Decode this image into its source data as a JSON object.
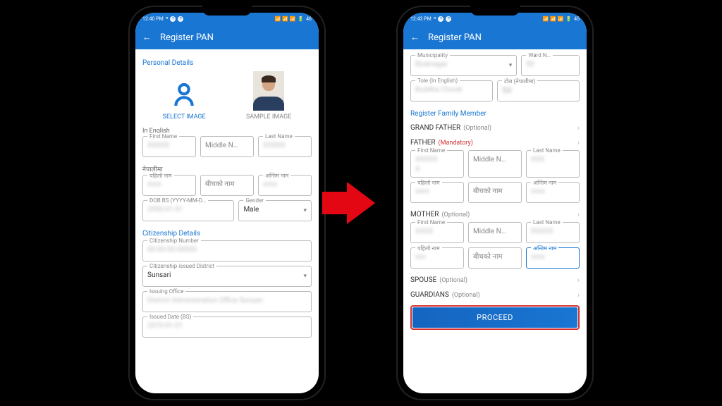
{
  "statusbar_left": {
    "time1": "12:40 PM",
    "time2": "12:43 PM",
    "quote": "❝"
  },
  "statusbar_right": {
    "net1": "46",
    "net2": "45"
  },
  "appbar": {
    "title": "Register PAN"
  },
  "left": {
    "section_personal": "Personal Details",
    "select_image": "SELECT IMAGE",
    "sample_image": "SAMPLE IMAGE",
    "in_english": "In English",
    "first_name_label": "First Name",
    "middle_name_place": "Middle N…",
    "last_name_label": "Last Name",
    "nepali_label": "नेपालीमा",
    "p_first_label": "पहिलो नाम",
    "p_middle_place": "बीचको नाम",
    "p_last_label": "अन्तिम नाम",
    "dob_label": "DOB BS (YYYY-MM-D…",
    "gender_label": "Gender",
    "gender_value": "Male",
    "section_citizen": "Citizenship Details",
    "cit_num_label": "Citizenship Number",
    "cit_dist_label": "Citizenship issued District",
    "cit_dist_value": "Sunsari",
    "issuing_office_label": "Issuing Office",
    "issued_date_label": "Issued Date (BS)"
  },
  "right": {
    "muni_label": "Municipality",
    "ward_label": "Ward N…",
    "tole_en_label": "Tole (In English)",
    "tole_np_label": "टोल (नेपालीमा)",
    "section_family": "Register Family Member",
    "grand_father": "GRAND FATHER",
    "father": "FATHER",
    "mother": "MOTHER",
    "spouse": "SPOUSE",
    "guardians": "GUARDIANS",
    "optional": "(Optional)",
    "mandatory": "(Mandatory)",
    "first_name_label": "First Name",
    "middle_name_place": "Middle N…",
    "last_name_label": "Last Name",
    "p_first_label": "पहिलो नाम",
    "p_middle_place": "बीचको नाम",
    "p_last_label": "अन्तिम नाम",
    "proceed": "PROCEED"
  }
}
